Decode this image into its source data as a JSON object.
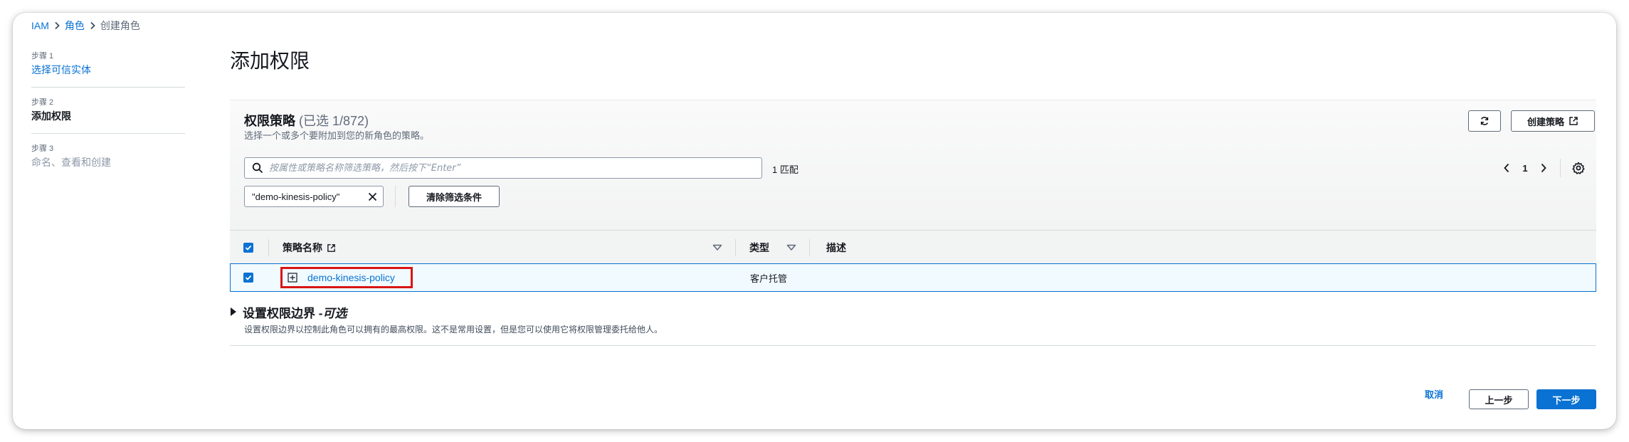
{
  "breadcrumb": {
    "items": [
      {
        "label": "IAM"
      },
      {
        "label": "角色"
      },
      {
        "label": "创建角色"
      }
    ]
  },
  "steps": [
    {
      "number": "步骤 1",
      "title": "选择可信实体",
      "state": "done"
    },
    {
      "number": "步骤 2",
      "title": "添加权限",
      "state": "active"
    },
    {
      "number": "步骤 3",
      "title": "命名、查看和创建",
      "state": "pending"
    }
  ],
  "page": {
    "title": "添加权限"
  },
  "policies": {
    "title": "权限策略",
    "count": "(已选 1/872)",
    "description": "选择一个或多个要附加到您的新角色的策略。",
    "refresh_icon": "refresh-icon",
    "create_button": "创建策略",
    "search_placeholder": "按属性或策略名称筛选策略，然后按下“Enter”",
    "match_count": "1 匹配",
    "page_number": "1",
    "filter_token": "\"demo-kinesis-policy\"",
    "clear_filters": "清除筛选条件",
    "columns": {
      "name": "策略名称",
      "type": "类型",
      "description": "描述"
    },
    "rows": [
      {
        "name": "demo-kinesis-policy",
        "type": "客户托管",
        "description": "",
        "selected": true
      }
    ]
  },
  "boundary": {
    "title": "设置权限边界 - ",
    "optional": "可选",
    "description": "设置权限边界以控制此角色可以拥有的最高权限。这不是常用设置，但是您可以使用它将权限管理委托给他人。"
  },
  "footer": {
    "cancel": "取消",
    "previous": "上一步",
    "next": "下一步"
  },
  "colors": {
    "link": "#0972d3",
    "primary": "#0972d3",
    "highlight": "#d91515",
    "selected_row_bg": "#f1faff"
  }
}
